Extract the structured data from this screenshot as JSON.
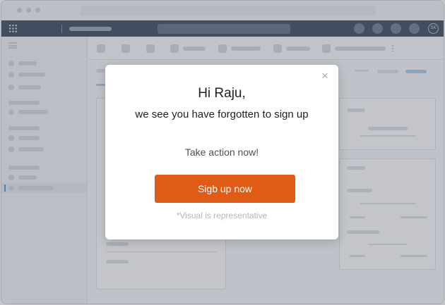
{
  "topnav": {
    "avatar_initials": "SK"
  },
  "modal": {
    "close_symbol": "×",
    "greeting": "Hi Raju,",
    "message": "we see you have forgotten to sign up",
    "call_to_action": "Take action now!",
    "signup_button_label": "Sigb up now",
    "disclaimer": "*Visual is representative"
  },
  "colors": {
    "nav_background": "#1f2d45",
    "signup_button": "#e05b16",
    "overlay": "rgba(116,122,133,0.42)"
  },
  "icons": [
    "grid-icon",
    "menu-icon",
    "close-icon",
    "more-icon"
  ]
}
